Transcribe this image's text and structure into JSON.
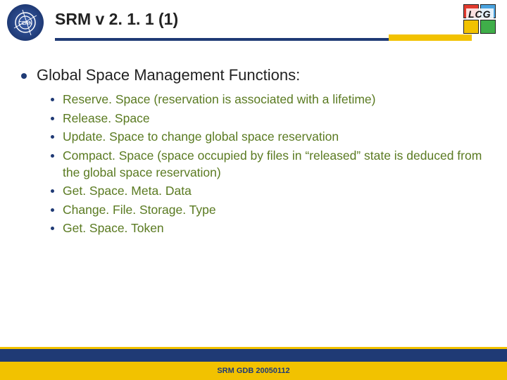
{
  "header": {
    "title": "SRM v 2. 1. 1 (1)",
    "lcg_label": "LCG"
  },
  "main_bullet": "Global Space Management Functions:",
  "sub_bullets": [
    "Reserve. Space (reservation is associated with a lifetime)",
    "Release. Space",
    "Update. Space to change global space reservation",
    "Compact. Space (space occupied by files in “released” state is deduced from the global space reservation)",
    "Get. Space. Meta. Data",
    "Change. File. Storage. Type",
    "Get. Space. Token"
  ],
  "footer": "SRM GDB 20050112"
}
